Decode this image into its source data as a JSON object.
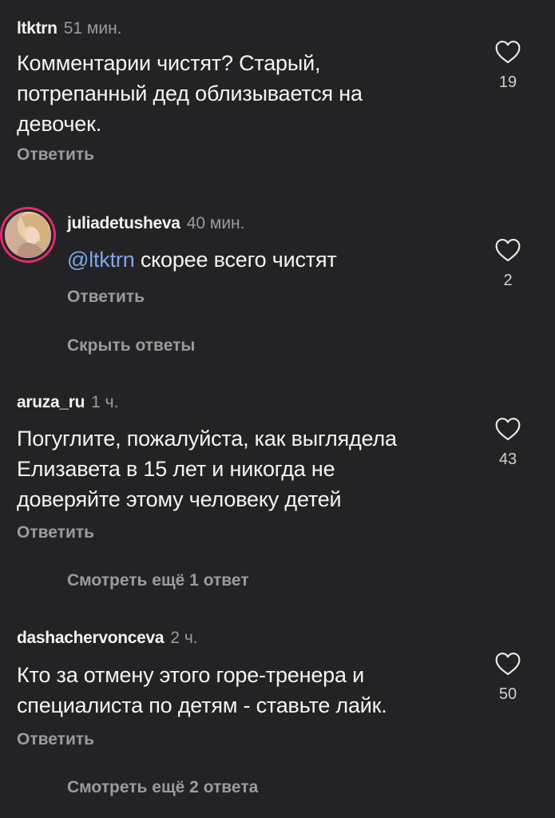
{
  "comments": [
    {
      "username": "ltktrn",
      "time": "51 мин.",
      "lines": [
        "Комментарии чистят? Старый,",
        "потрепанный дед облизывается на",
        "девочек."
      ],
      "reply_label": "Ответить",
      "likes": "19"
    },
    {
      "username": "juliadetusheva",
      "time": "40 мин.",
      "mention": "@ltktrn",
      "text": " скорее всего чистят",
      "reply_label": "Ответить",
      "likes": "2",
      "thread_label": "Скрыть ответы"
    },
    {
      "username": "aruza_ru",
      "time": "1 ч.",
      "lines": [
        "Погуглите, пожалуйста, как выглядела",
        "Елизавета в 15 лет и никогда не",
        "доверяйте этому человеку детей"
      ],
      "reply_label": "Ответить",
      "likes": "43",
      "thread_label": "Смотреть ещё 1 ответ"
    },
    {
      "username": "dashachervonceva",
      "time": "2 ч.",
      "lines": [
        "Кто за отмену этого горе-тренера и",
        "специалиста по детям - ставьте лайк."
      ],
      "reply_label": "Ответить",
      "likes": "50",
      "thread_label": "Смотреть ещё 2 ответа"
    }
  ],
  "colors": {
    "background": "#232326",
    "text": "#f4f4f4",
    "muted": "#9b9b9e",
    "mention": "#7fa6ec",
    "avatar_ring": "#e32a6f"
  },
  "icons": {
    "like": "heart-outline-icon"
  }
}
